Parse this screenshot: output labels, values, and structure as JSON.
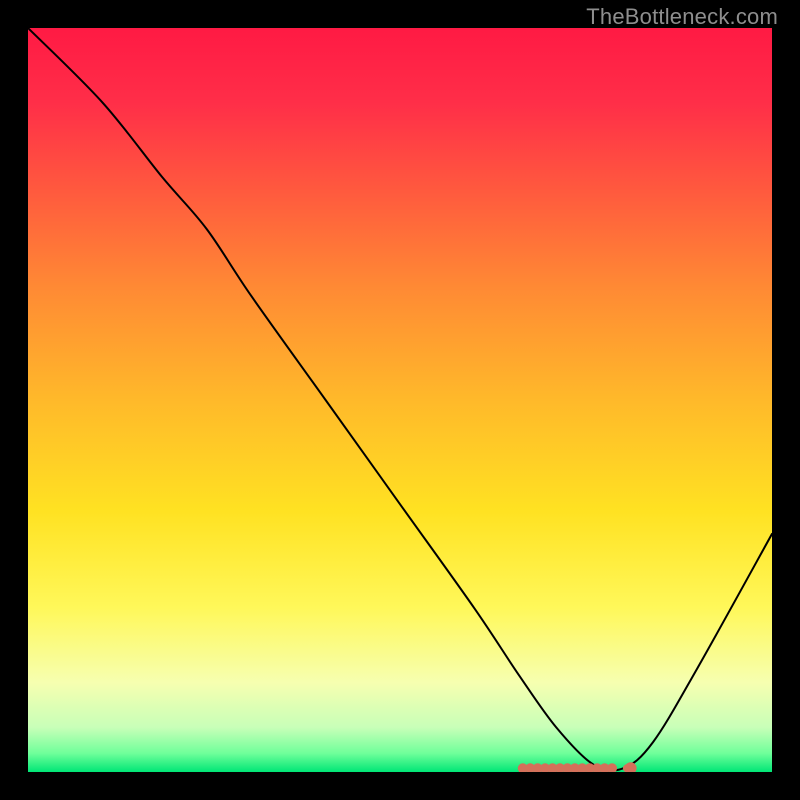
{
  "watermark": "TheBottleneck.com",
  "chart_data": {
    "type": "line",
    "title": "",
    "xlabel": "",
    "ylabel": "",
    "xlim": [
      0,
      100
    ],
    "ylim": [
      0,
      100
    ],
    "background_gradient": {
      "stops": [
        {
          "offset": 0.0,
          "color": "#ff1a44"
        },
        {
          "offset": 0.1,
          "color": "#ff2e48"
        },
        {
          "offset": 0.22,
          "color": "#ff5a3e"
        },
        {
          "offset": 0.35,
          "color": "#ff8a34"
        },
        {
          "offset": 0.5,
          "color": "#ffb92a"
        },
        {
          "offset": 0.65,
          "color": "#ffe222"
        },
        {
          "offset": 0.78,
          "color": "#fff85a"
        },
        {
          "offset": 0.88,
          "color": "#f6ffb0"
        },
        {
          "offset": 0.94,
          "color": "#c8ffb8"
        },
        {
          "offset": 0.975,
          "color": "#6fff9a"
        },
        {
          "offset": 1.0,
          "color": "#00e676"
        }
      ]
    },
    "series": [
      {
        "name": "bottleneck-curve",
        "color": "#000000",
        "x": [
          0.0,
          10.0,
          18.0,
          24.0,
          30.0,
          40.0,
          50.0,
          60.0,
          66.0,
          71.0,
          76.0,
          80.0,
          84.0,
          90.0,
          100.0
        ],
        "values": [
          100.0,
          90.0,
          80.0,
          73.0,
          64.0,
          50.0,
          36.0,
          22.0,
          13.0,
          6.0,
          1.0,
          0.5,
          4.0,
          14.0,
          32.0
        ]
      }
    ],
    "markers": {
      "name": "optimum-cluster",
      "color": "#d4705a",
      "x": [
        66.5,
        67.5,
        68.5,
        69.5,
        70.5,
        71.5,
        72.5,
        73.5,
        74.5,
        75.5,
        76.5,
        77.5,
        78.5,
        80.5,
        81.0
      ],
      "y": [
        0.5,
        0.5,
        0.5,
        0.5,
        0.5,
        0.5,
        0.5,
        0.5,
        0.5,
        0.5,
        0.5,
        0.5,
        0.5,
        0.5,
        0.5
      ],
      "radius": [
        5,
        5,
        5,
        5,
        5,
        5,
        5,
        5,
        5,
        5,
        5,
        5,
        5,
        4,
        6
      ]
    }
  }
}
